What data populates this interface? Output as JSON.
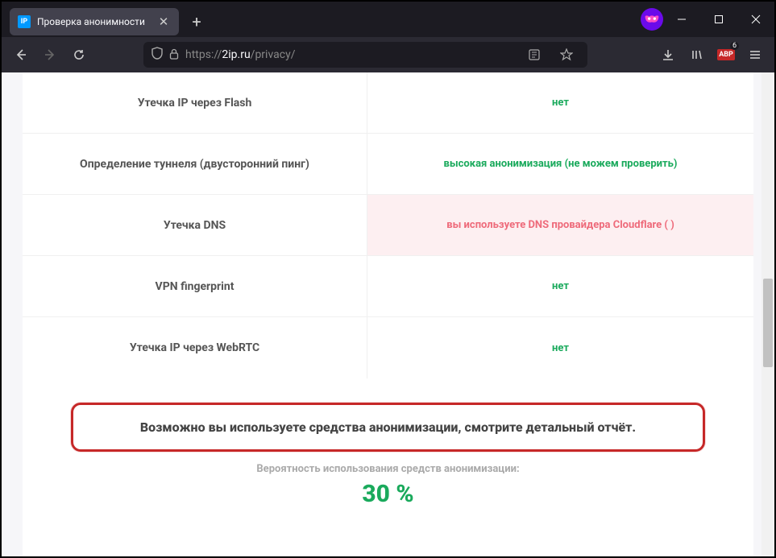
{
  "tab": {
    "favicon_text": "IP",
    "title": "Проверка анонимности"
  },
  "url": {
    "protocol": "https://",
    "domain": "2ip.ru",
    "path": "/privacy/"
  },
  "toolbar": {
    "abp": "ABP",
    "abp_count": "6"
  },
  "rows": [
    {
      "label": "Утечка IP через Flash",
      "value": "нет",
      "status": "green"
    },
    {
      "label": "Определение туннеля (двусторонний пинг)",
      "value": "высокая анонимизация (не можем проверить)",
      "status": "green"
    },
    {
      "label": "Утечка DNS",
      "value": "вы используете DNS провайдера Cloudflare (                       )",
      "status": "red"
    },
    {
      "label": "VPN fingerprint",
      "value": "нет",
      "status": "green"
    },
    {
      "label": "Утечка IP через WebRTC",
      "value": "нет",
      "status": "green"
    }
  ],
  "summary": {
    "message": "Возможно вы используете средства анонимизации, смотрите детальный отчёт.",
    "prob_label": "Вероятность использования средств анонимизации:",
    "prob_value": "30 %"
  }
}
